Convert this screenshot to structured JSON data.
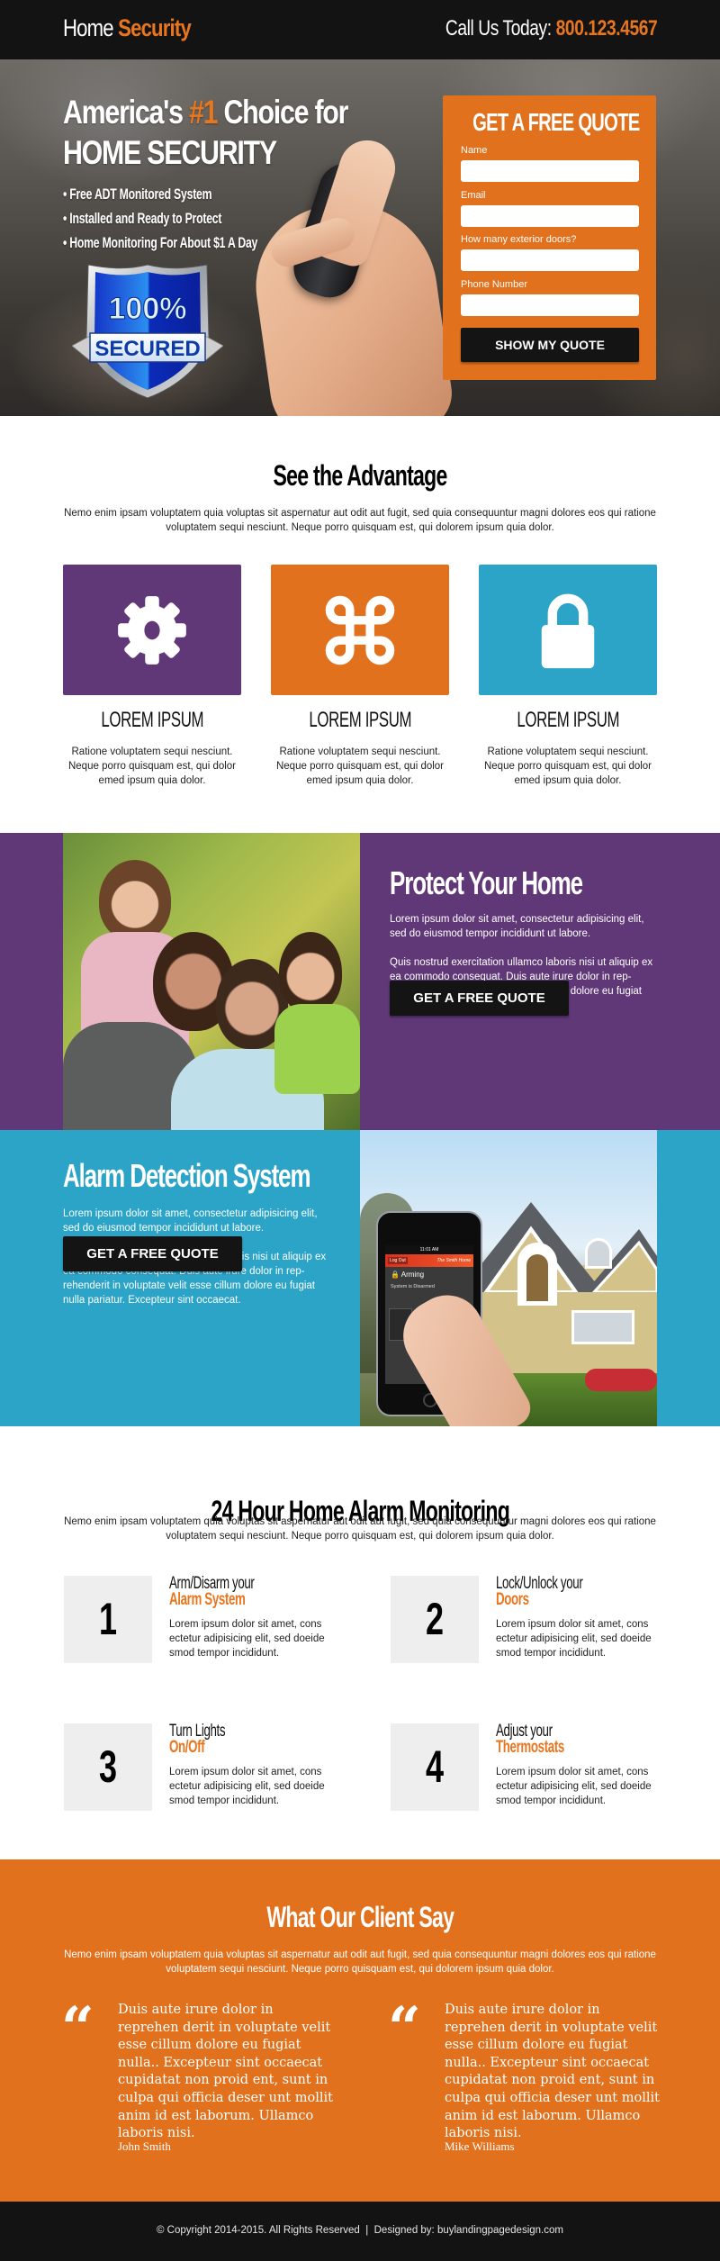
{
  "header": {
    "logo_part1": "Home",
    "logo_part2": "Security",
    "call_label": "Call Us Today:",
    "phone": "800.123.4567"
  },
  "colors": {
    "orange": "#E2711D",
    "purple": "#603878",
    "blue": "#2BA4C8",
    "dark": "#131313",
    "light_box": "#EEEEEE"
  },
  "hero": {
    "headline_pre": "America's",
    "headline_highlight": "#1",
    "headline_post": "Choice for",
    "headline_line2": "HOME SECURITY",
    "bullets": [
      "• Free ADT Monitored System",
      "• Installed and Ready to Protect",
      "• Home Monitoring For About $1 A Day"
    ],
    "badge_top": "100%",
    "badge_bottom": "SECURED"
  },
  "quote_form": {
    "title": "GET A FREE QUOTE",
    "fields": [
      {
        "label": "Name",
        "value": "",
        "placeholder": ""
      },
      {
        "label": "Email",
        "value": "",
        "placeholder": ""
      },
      {
        "label": "How many exterior doors?",
        "value": "",
        "placeholder": ""
      },
      {
        "label": "Phone Number",
        "value": "",
        "placeholder": ""
      }
    ],
    "submit_label": "SHOW MY QUOTE"
  },
  "advantage": {
    "title": "See the Advantage",
    "intro": "Nemo enim ipsam voluptatem quia voluptas sit aspernatur aut odit aut fugit, sed quia consequuntur magni dolores eos qui ratione voluptatem sequi nesciunt. Neque porro quisquam est, qui dolorem ipsum quia dolor.",
    "features": [
      {
        "icon": "gear-icon",
        "title": "LOREM IPSUM",
        "text": "Ratione voluptatem sequi nesciunt. Neque porro quisquam est, qui dolor emed ipsum quia dolor.",
        "color": "#603878"
      },
      {
        "icon": "command-icon",
        "title": "LOREM IPSUM",
        "text": "Ratione voluptatem sequi nesciunt. Neque porro quisquam est, qui dolor emed ipsum quia dolor.",
        "color": "#E2711D"
      },
      {
        "icon": "lock-icon",
        "title": "LOREM IPSUM",
        "text": "Ratione voluptatem sequi nesciunt. Neque porro quisquam est, qui dolor emed ipsum quia dolor.",
        "color": "#2BA4C8"
      }
    ]
  },
  "protect": {
    "title": "Protect Your Home",
    "p1": "Lorem ipsum dolor sit amet, consectetur adipisicing elit, sed do eiusmod tempor incididunt ut labore.",
    "p2": "Quis nostrud exercitation ullamco laboris nisi ut aliquip ex ea commodo consequat. Duis aute irure dolor in rep-rehenderit in voluptate velit esse cillum dolore eu fugiat nulla pariatur. Excepteur sint occaecat.",
    "button_label": "GET A FREE QUOTE",
    "image_alt": "family photo"
  },
  "alarm": {
    "title": "Alarm Detection System",
    "p1": "Lorem ipsum dolor sit amet, consectetur adipisicing elit, sed do eiusmod tempor incididunt ut labore.",
    "p2": "Quis nostrud exercitation ullamco laboris nisi ut aliquip ex ea commodo consequat. Duis aute irure dolor in rep-rehenderit in voluptate velit esse cillum dolore eu fugiat nulla pariatur. Excepteur sint occaecat.",
    "button_label": "GET A FREE QUOTE",
    "phone_screen": {
      "time": "11:01 AM",
      "logout": "Log Out",
      "home_name": "The Smith Home",
      "arming": "Arming",
      "status": "System is Disarmed"
    }
  },
  "monitoring": {
    "title": "24 Hour Home Alarm Monitoring",
    "intro": "Nemo enim ipsam voluptatem quia voluptas sit aspernatur aut odit aut fugit, sed quia consequuntur magni dolores eos qui ratione voluptatem sequi nesciunt. Neque porro quisquam est, qui dolorem ipsum quia dolor.",
    "steps": [
      {
        "number": "1",
        "line1": "Arm/Disarm your",
        "line2": "Alarm System",
        "text": "Lorem ipsum dolor sit amet, cons ectetur adipisicing elit, sed doeide smod tempor incididunt."
      },
      {
        "number": "2",
        "line1": "Lock/Unlock your",
        "line2": "Doors",
        "text": "Lorem ipsum dolor sit amet, cons ectetur adipisicing elit, sed doeide smod tempor incididunt."
      },
      {
        "number": "3",
        "line1": "Turn Lights",
        "line2": "On/Off",
        "text": "Lorem ipsum dolor sit amet, cons ectetur adipisicing elit, sed doeide smod tempor incididunt."
      },
      {
        "number": "4",
        "line1": "Adjust your",
        "line2": "Thermostats",
        "text": "Lorem ipsum dolor sit amet, cons ectetur adipisicing elit, sed doeide smod tempor incididunt."
      }
    ]
  },
  "testimonials": {
    "title": "What Our Client Say",
    "intro": "Nemo enim ipsam voluptatem quia voluptas sit aspernatur aut odit aut fugit, sed quia consequuntur magni dolores eos qui ratione voluptatem sequi nesciunt. Neque porro quisquam est, qui dolorem ipsum quia dolor.",
    "quote_glyph": "“",
    "items": [
      {
        "text": "Duis aute irure dolor in reprehen derit in voluptate velit esse cillum dolore eu fugiat nulla.. Excepteur sint occaecat cupidatat non proid ent, sunt in culpa qui officia deser unt mollit anim id est laborum. Ullamco laboris nisi.",
        "name": "John Smith"
      },
      {
        "text": "Duis aute irure dolor in reprehen derit in voluptate velit esse cillum dolore eu fugiat nulla.. Excepteur sint occaecat cupidatat non proid ent, sunt in culpa qui officia deser unt mollit anim id est laborum. Ullamco laboris nisi.",
        "name": "Mike Williams"
      }
    ]
  },
  "footer": {
    "copyright": "© Copyright 2014-2015. All Rights Reserved",
    "separator": "|",
    "designed_by_label": "Designed by:",
    "designer_link": "buylandingpagedesign.com"
  }
}
